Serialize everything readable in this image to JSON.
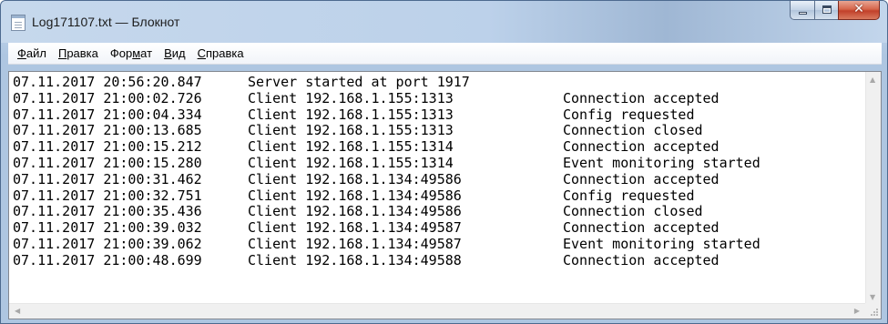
{
  "window": {
    "title": "Log171107.txt — Блокнот",
    "icon": "notepad-icon",
    "controls": {
      "minimize": "minimize-icon",
      "maximize": "maximize-icon",
      "close": "✕"
    }
  },
  "menu": {
    "items": [
      {
        "accel": "Ф",
        "rest": "айл"
      },
      {
        "accel": "П",
        "rest": "равка"
      },
      {
        "pre": "Фор",
        "accel": "м",
        "rest": "ат"
      },
      {
        "accel": "В",
        "rest": "ид"
      },
      {
        "accel": "С",
        "rest": "правка"
      }
    ]
  },
  "log": {
    "lines": [
      {
        "ts": "07.11.2017 20:56:20.847",
        "src": "Server started at port 1917",
        "msg": ""
      },
      {
        "ts": "07.11.2017 21:00:02.726",
        "src": "Client 192.168.1.155:1313",
        "msg": "Connection accepted"
      },
      {
        "ts": "07.11.2017 21:00:04.334",
        "src": "Client 192.168.1.155:1313",
        "msg": "Config requested"
      },
      {
        "ts": "07.11.2017 21:00:13.685",
        "src": "Client 192.168.1.155:1313",
        "msg": "Connection closed"
      },
      {
        "ts": "07.11.2017 21:00:15.212",
        "src": "Client 192.168.1.155:1314",
        "msg": "Connection accepted"
      },
      {
        "ts": "07.11.2017 21:00:15.280",
        "src": "Client 192.168.1.155:1314",
        "msg": "Event monitoring started"
      },
      {
        "ts": "07.11.2017 21:00:31.462",
        "src": "Client 192.168.1.134:49586",
        "msg": "Connection accepted"
      },
      {
        "ts": "07.11.2017 21:00:32.751",
        "src": "Client 192.168.1.134:49586",
        "msg": "Config requested"
      },
      {
        "ts": "07.11.2017 21:00:35.436",
        "src": "Client 192.168.1.134:49586",
        "msg": "Connection closed"
      },
      {
        "ts": "07.11.2017 21:00:39.032",
        "src": "Client 192.168.1.134:49587",
        "msg": "Connection accepted"
      },
      {
        "ts": "07.11.2017 21:00:39.062",
        "src": "Client 192.168.1.134:49587",
        "msg": "Event monitoring started"
      },
      {
        "ts": "07.11.2017 21:00:48.699",
        "src": "Client 192.168.1.134:49588",
        "msg": "Connection accepted"
      }
    ]
  },
  "scrollbars": {
    "up": "▲",
    "down": "▼",
    "left": "◀",
    "right": "▶"
  }
}
